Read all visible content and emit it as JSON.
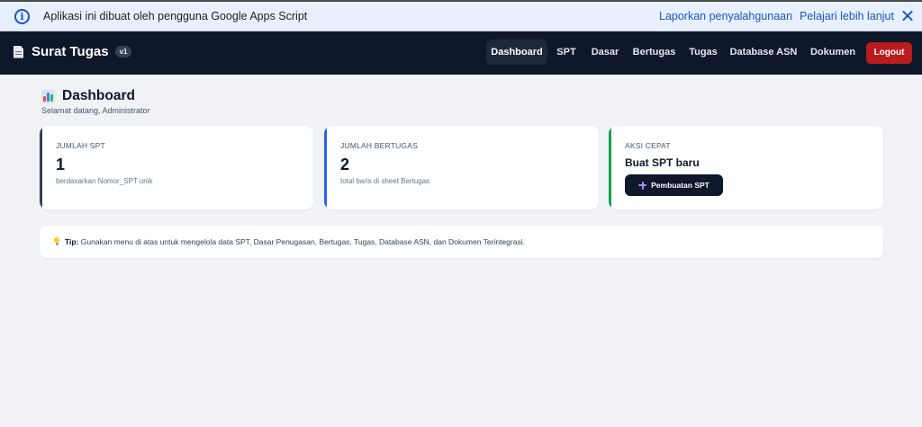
{
  "gas_banner": {
    "message": "Aplikasi ini dibuat oleh pengguna Google Apps Script",
    "report_link": "Laporkan penyalahgunaan",
    "learn_link": "Pelajari lebih lanjut",
    "info_icon": "info-icon",
    "close_icon": "close-icon"
  },
  "navbar": {
    "brand_icon": "document-icon",
    "brand_title": "Surat Tugas",
    "brand_badge": "v1",
    "items": [
      {
        "label": "Dashboard",
        "active": true
      },
      {
        "label": "SPT"
      },
      {
        "label": "Dasar"
      },
      {
        "label": "Bertugas"
      },
      {
        "label": "Tugas"
      },
      {
        "label": "Database ASN"
      },
      {
        "label": "Dokumen"
      }
    ],
    "logout_label": "Logout"
  },
  "page": {
    "title_icon": "bar-chart-icon",
    "title": "Dashboard",
    "subtitle": "Selamat datang, Administrator"
  },
  "cards": {
    "spt": {
      "label": "JUMLAH SPT",
      "value": "1",
      "hint": "berdasarkan Nomor_SPT unik",
      "accent": "#334155"
    },
    "bertugas": {
      "label": "JUMLAH BERTUGAS",
      "value": "2",
      "hint": "total baris di sheet Bertugas",
      "accent": "#2563eb"
    },
    "aksi": {
      "label": "AKSI CEPAT",
      "heading": "Buat SPT baru",
      "button_label": "Pembuatan SPT",
      "button_icon": "plus-icon",
      "accent": "#16a34a"
    }
  },
  "tip": {
    "icon": "lightbulb-icon",
    "prefix": "Tip:",
    "text": " Gunakan menu di atas untuk mengelola data SPT, Dasar Penugasan, Bertugas, Tugas, Database ASN, dan Dokumen Terintegrasi."
  },
  "colors": {
    "navbar_bg": "#0f172a",
    "logout_bg": "#b91c1c",
    "page_bg": "#f0f2f6",
    "banner_bg": "#e8effd",
    "link": "#1a56c4"
  }
}
